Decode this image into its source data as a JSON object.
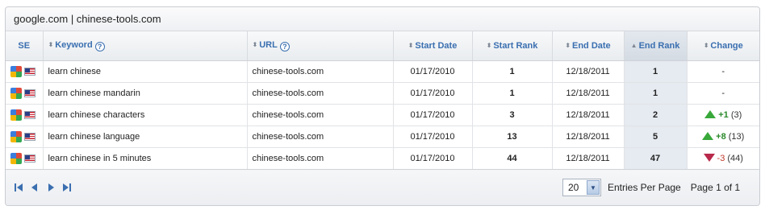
{
  "panel": {
    "title": "google.com | chinese-tools.com"
  },
  "columns": {
    "se": "SE",
    "keyword": "Keyword",
    "url": "URL",
    "start_date": "Start Date",
    "start_rank": "Start Rank",
    "end_date": "End Date",
    "end_rank": "End Rank",
    "change": "Change"
  },
  "help_glyph": "?",
  "rows": [
    {
      "keyword": "learn chinese",
      "url": "chinese-tools.com",
      "start_date": "01/17/2010",
      "start_rank": "1",
      "end_date": "12/18/2011",
      "end_rank": "1",
      "change": "-",
      "change_dir": "none",
      "change_paren": ""
    },
    {
      "keyword": "learn chinese mandarin",
      "url": "chinese-tools.com",
      "start_date": "01/17/2010",
      "start_rank": "1",
      "end_date": "12/18/2011",
      "end_rank": "1",
      "change": "-",
      "change_dir": "none",
      "change_paren": ""
    },
    {
      "keyword": "learn chinese characters",
      "url": "chinese-tools.com",
      "start_date": "01/17/2010",
      "start_rank": "3",
      "end_date": "12/18/2011",
      "end_rank": "2",
      "change": "+1",
      "change_dir": "up",
      "change_paren": "(3)"
    },
    {
      "keyword": "learn chinese language",
      "url": "chinese-tools.com",
      "start_date": "01/17/2010",
      "start_rank": "13",
      "end_date": "12/18/2011",
      "end_rank": "5",
      "change": "+8",
      "change_dir": "up",
      "change_paren": "(13)"
    },
    {
      "keyword": "learn chinese in 5 minutes",
      "url": "chinese-tools.com",
      "start_date": "01/17/2010",
      "start_rank": "44",
      "end_date": "12/18/2011",
      "end_rank": "47",
      "change": "-3",
      "change_dir": "down",
      "change_paren": "(44)"
    }
  ],
  "footer": {
    "per_page_value": "20",
    "per_page_label": "Entries Per Page",
    "page_info": "Page 1 of 1"
  },
  "colors": {
    "header_text": "#3a6fb0",
    "up": "#38a83a",
    "down": "#b8294b",
    "end_rank_bg": "#e6ebf1"
  }
}
